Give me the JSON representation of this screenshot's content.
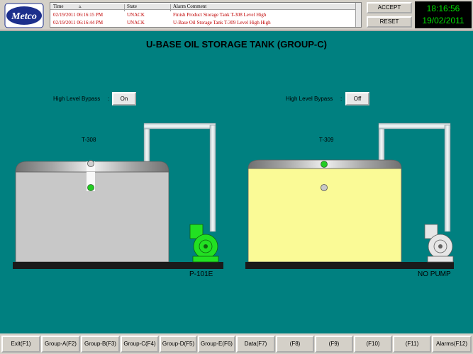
{
  "header": {
    "logo_text": "Metco",
    "alarm_table": {
      "columns": [
        "Time",
        "State",
        "Alarm Comment"
      ],
      "rows": [
        {
          "time": "02/19/2011 06:16:15 PM",
          "state": "UNACK",
          "comment": "Finish Product Storage Tank T-308 Level High"
        },
        {
          "time": "02/19/2011 06:16:44 PM",
          "state": "UNACK",
          "comment": "U-Base Oil Storage Tank T-309 Level High High"
        }
      ]
    },
    "accept_label": "ACCEPT",
    "reset_label": "RESET",
    "clock_time": "18:16:56",
    "clock_date": "19/02/2011"
  },
  "main": {
    "title": "U-BASE OIL STORAGE TANK (GROUP-C)",
    "left": {
      "bypass_label": "High Level Bypass",
      "bypass_value": "On",
      "tank_tag": "T-308",
      "pump_label": "P-101E",
      "tank_color": "#c8c8c8",
      "pump_color": "#22e022",
      "pump_state": "running"
    },
    "right": {
      "bypass_label": "High Level Bypass",
      "bypass_value": "Off",
      "tank_tag": "T-309",
      "pump_label": "NO PUMP",
      "tank_color": "#fafa96",
      "pump_color": "#e6e6e6",
      "pump_state": "none"
    },
    "colors": {
      "background": "#008080",
      "active_indicator": "#22cc22",
      "inactive_indicator": "#c8c8c8"
    }
  },
  "fkeys": [
    "Exit(F1)",
    "Group-A(F2)",
    "Group-B(F3)",
    "Group-C(F4)",
    "Group-D(F5)",
    "Group-E(F6)",
    "Data(F7)",
    "(F8)",
    "(F9)",
    "(F10)",
    "(F11)",
    "Alarms(F12)"
  ]
}
